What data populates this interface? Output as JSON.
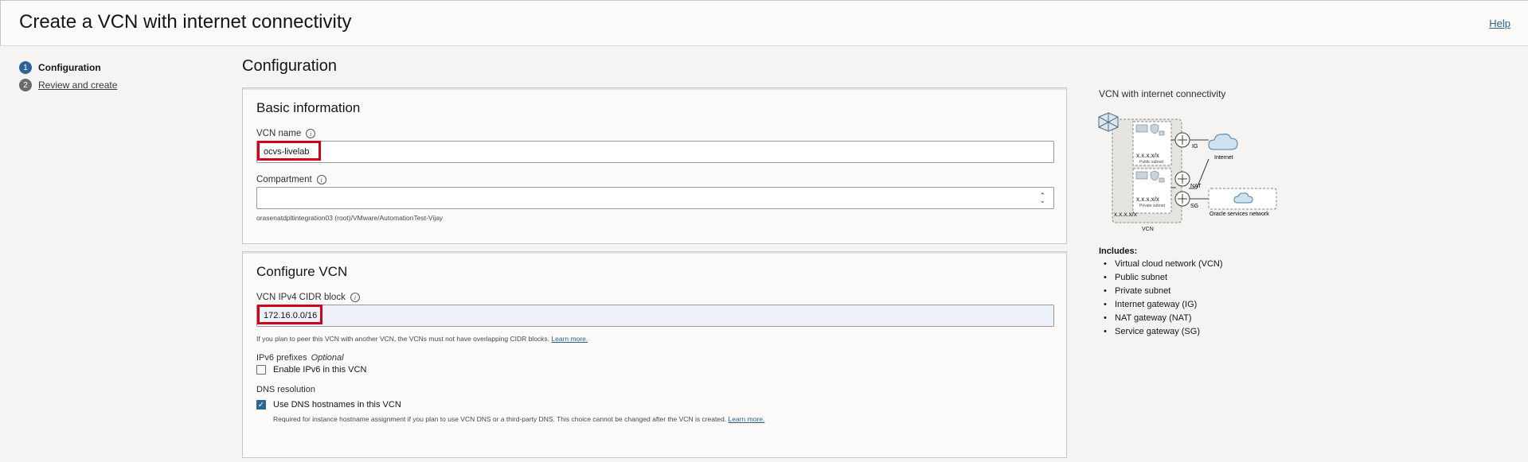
{
  "header": {
    "title": "Create a VCN with internet connectivity",
    "help": "Help"
  },
  "steps": [
    {
      "num": "1",
      "label": "Configuration",
      "active": true
    },
    {
      "num": "2",
      "label": "Review and create",
      "active": false
    }
  ],
  "main": {
    "title": "Configuration",
    "basic": {
      "title": "Basic information",
      "vcn_name_label": "VCN name",
      "vcn_name_value": "ocvs-livelab",
      "compartment_label": "Compartment",
      "compartment_value": "",
      "compartment_path": "orasenatdpltintegration03 (root)/VMware/AutomationTest-Vijay"
    },
    "configure": {
      "title": "Configure VCN",
      "cidr_label": "VCN IPv4 CIDR block",
      "cidr_value": "172.16.0.0/16",
      "cidr_hint": "If you plan to peer this VCN with another VCN, the VCNs must not have overlapping CIDR blocks.",
      "learn_more": "Learn more.",
      "ipv6_label": "IPv6 prefixes",
      "ipv6_optional": "Optional",
      "ipv6_checkbox": "Enable IPv6 in this VCN",
      "dns_label": "DNS resolution",
      "dns_checkbox": "Use DNS hostnames in this VCN",
      "dns_hint": "Required for instance hostname assignment if you plan to use VCN DNS or a third-party DNS. This choice cannot be changed after the VCN is created."
    }
  },
  "diagram": {
    "title": "VCN with internet connectivity",
    "cidr_vcn": "x.x.x.x/x",
    "cidr_public": "x.x.x.x/x",
    "cidr_private": "x.x.x.x/x",
    "public_subnet": "Public subnet",
    "private_subnet": "Private subnet",
    "vcn": "VCN",
    "ig": "IG",
    "nat": "NAT",
    "sg": "SG",
    "internet": "Internet",
    "oracle_services": "Oracle services network"
  },
  "includes": {
    "title": "Includes:",
    "items": [
      "Virtual cloud network (VCN)",
      "Public subnet",
      "Private subnet",
      "Internet gateway (IG)",
      "NAT gateway (NAT)",
      "Service gateway (SG)"
    ]
  },
  "colors": {
    "accent": "#2b6496",
    "highlight": "#d1001b",
    "link": "#2c5f88"
  }
}
